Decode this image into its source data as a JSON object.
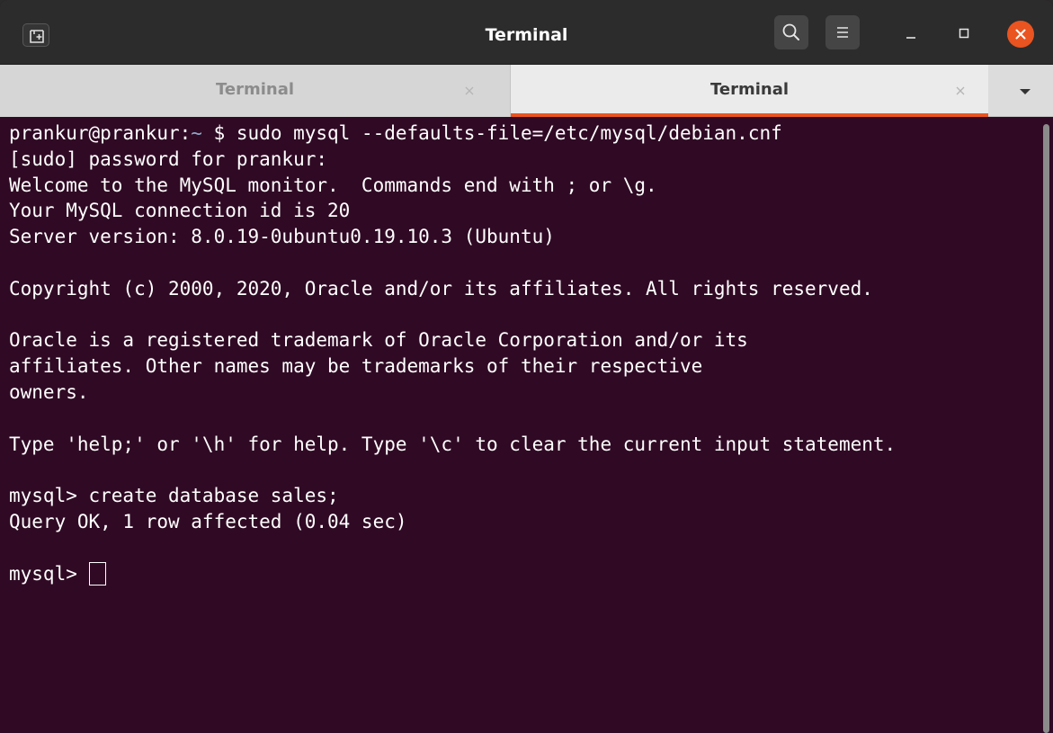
{
  "window": {
    "title": "Terminal",
    "icons": {
      "new_tab": "new-tab-icon",
      "search": "search-icon",
      "menu": "hamburger-menu-icon",
      "minimize": "minimize-icon",
      "maximize": "maximize-icon",
      "close": "close-icon"
    }
  },
  "tabs": [
    {
      "label": "Terminal",
      "active": false
    },
    {
      "label": "Terminal",
      "active": true
    }
  ],
  "colors": {
    "terminal_bg": "#300a24",
    "accent": "#e95420",
    "prompt_path": "#8fa7c9",
    "text": "#ffffff"
  },
  "terminal": {
    "prompt_user": "prankur@prankur:",
    "prompt_path": "~",
    "prompt_symbol": " $ ",
    "first_command": "sudo mysql --defaults-file=/etc/mysql/debian.cnf",
    "lines": [
      "[sudo] password for prankur:",
      "Welcome to the MySQL monitor.  Commands end with ; or \\g.",
      "Your MySQL connection id is 20",
      "Server version: 8.0.19-0ubuntu0.19.10.3 (Ubuntu)",
      "",
      "Copyright (c) 2000, 2020, Oracle and/or its affiliates. All rights reserved.",
      "",
      "Oracle is a registered trademark of Oracle Corporation and/or its",
      "affiliates. Other names may be trademarks of their respective",
      "owners.",
      "",
      "Type 'help;' or '\\h' for help. Type '\\c' to clear the current input statement.",
      "",
      "mysql> create database sales;",
      "Query OK, 1 row affected (0.04 sec)",
      ""
    ],
    "current_prompt": "mysql> "
  }
}
